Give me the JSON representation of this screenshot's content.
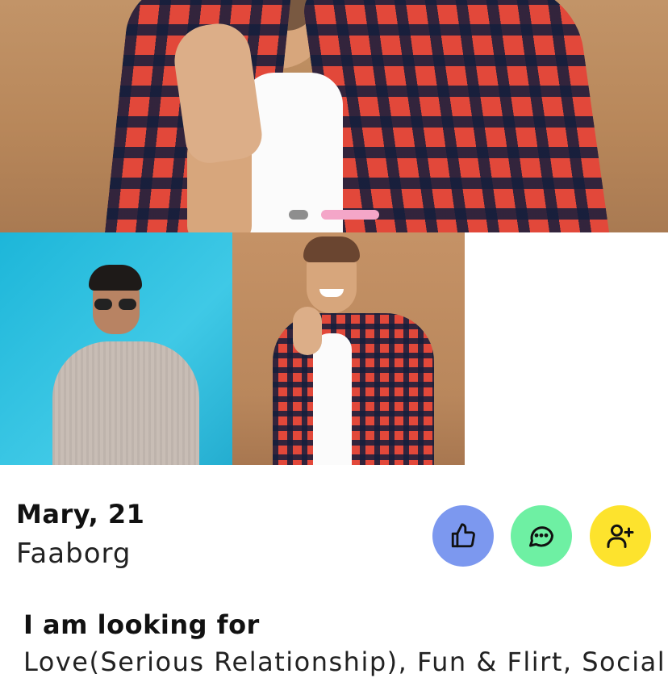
{
  "gallery": {
    "slide_count": 2,
    "active_slide": 2,
    "thumbnails": [
      "photo-1",
      "photo-2"
    ]
  },
  "profile": {
    "name_age": "Mary, 21",
    "location": "Faaborg"
  },
  "actions": [
    {
      "icon": "thumbs-up-icon",
      "color": "#7c98ef"
    },
    {
      "icon": "chat-bubble-icon",
      "color": "#6ef0a3"
    },
    {
      "icon": "add-user-icon",
      "color": "#fde32d"
    }
  ],
  "looking_for": {
    "title": "I am looking for",
    "text": "Love(Serious Relationship), Fun & Flirt, Social"
  }
}
